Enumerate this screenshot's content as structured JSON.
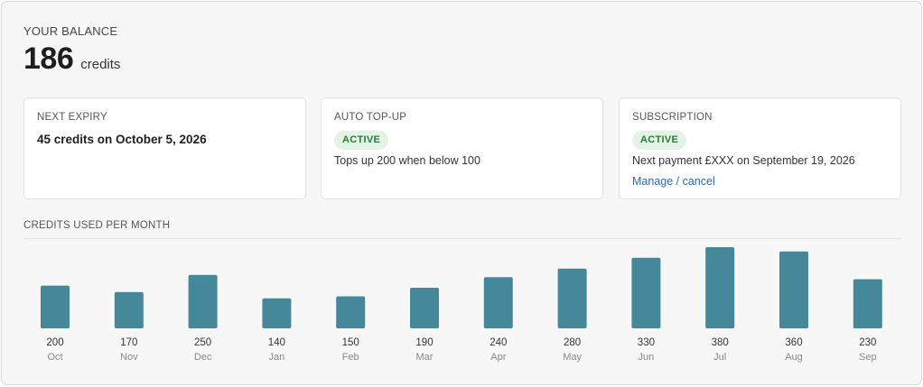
{
  "balance": {
    "label": "YOUR BALANCE",
    "value": "186",
    "unit": "credits"
  },
  "cards": {
    "expiry": {
      "title": "NEXT EXPIRY",
      "text": "45 credits on October 5, 2026"
    },
    "autotopup": {
      "title": "AUTO TOP-UP",
      "badge": "ACTIVE",
      "text": "Tops up 200 when below 100"
    },
    "subscription": {
      "title": "SUBSCRIPTION",
      "badge": "ACTIVE",
      "text": "Next payment £XXX on September 19, 2026",
      "link": "Manage / cancel"
    }
  },
  "colors": {
    "bar": "#44889a",
    "badge_bg": "#e3f4e6",
    "badge_text": "#2a7a37",
    "link": "#2c6aa8"
  },
  "chart_data": {
    "type": "bar",
    "title": "CREDITS USED PER MONTH",
    "categories": [
      "Oct",
      "Nov",
      "Dec",
      "Jan",
      "Feb",
      "Mar",
      "Apr",
      "May",
      "Jun",
      "Jul",
      "Aug",
      "Sep"
    ],
    "values": [
      200,
      170,
      250,
      140,
      150,
      190,
      240,
      280,
      330,
      380,
      360,
      230
    ],
    "ylim": [
      0,
      380
    ],
    "grid": false
  }
}
